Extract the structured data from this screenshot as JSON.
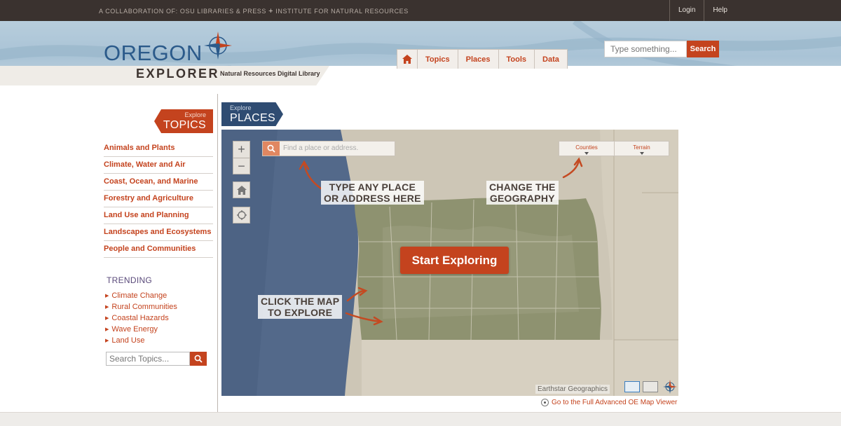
{
  "topbar": {
    "collab_prefix": "A COLLABORATION OF:",
    "collab_org1": "OSU LIBRARIES & PRESS",
    "collab_sep": "+",
    "collab_org2": "INSTITUTE FOR NATURAL RESOURCES",
    "login": "Login",
    "help": "Help"
  },
  "logo": {
    "word": "OREGON",
    "sub": "EXPLORER",
    "tagline": "Natural Resources Digital Library"
  },
  "nav": {
    "home_icon": "home-icon",
    "tabs": [
      "Topics",
      "Places",
      "Tools",
      "Data"
    ]
  },
  "header_search": {
    "placeholder": "Type something...",
    "button": "Search"
  },
  "topics_flag": {
    "small": "Explore",
    "big": "TOPICS"
  },
  "topics": [
    "Animals and Plants",
    "Climate, Water and Air",
    "Coast, Ocean, and Marine",
    "Forestry and Agriculture",
    "Land Use and Planning",
    "Landscapes and Ecosystems",
    "People and Communities"
  ],
  "trending": {
    "title": "TRENDING",
    "items": [
      "Climate Change",
      "Rural Communities",
      "Coastal Hazards",
      "Wave Energy",
      "Land Use"
    ]
  },
  "topic_search": {
    "placeholder": "Search Topics..."
  },
  "places_flag": {
    "small": "Explore",
    "big": "PLACES"
  },
  "map": {
    "zoom_in": "+",
    "zoom_out": "−",
    "search_placeholder": "Find a place or address.",
    "geo_options": [
      "Counties",
      "Terrain"
    ],
    "callout_search_1": "TYPE ANY PLACE",
    "callout_search_2": "OR ADDRESS HERE",
    "callout_geo_1": "CHANGE THE",
    "callout_geo_2": "GEOGRAPHY",
    "callout_click_1": "CLICK THE MAP",
    "callout_click_2": "TO EXPLORE",
    "start_button": "Start Exploring",
    "attribution": "Earthstar Geographics"
  },
  "full_viewer_link": "Go to the Full Advanced OE Map Viewer",
  "colors": {
    "accent": "#c4431e",
    "places_flag": "#2f4c72",
    "topbar": "#3a322f"
  }
}
